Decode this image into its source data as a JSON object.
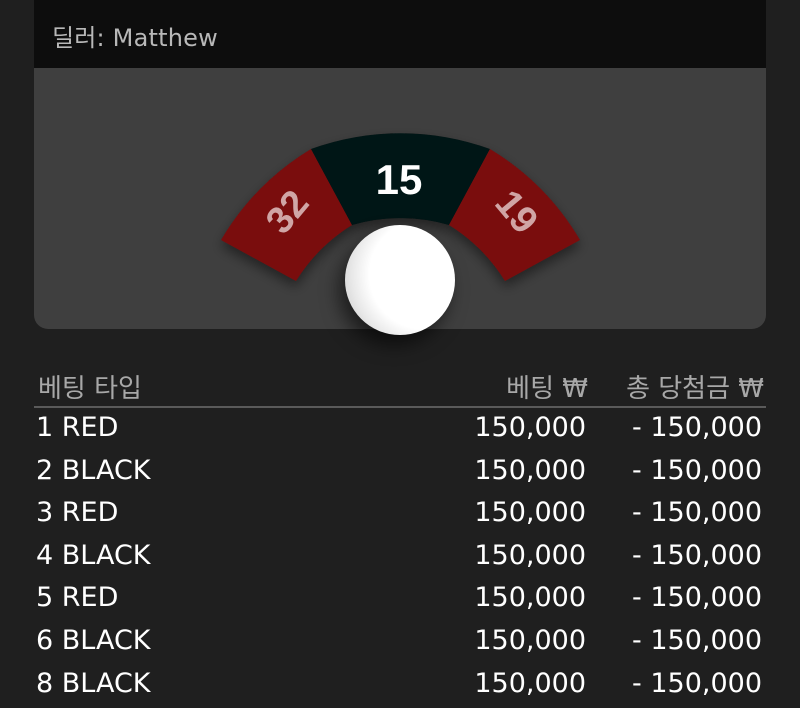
{
  "dealer": {
    "label": "딜러: Matthew"
  },
  "wheel": {
    "left_number": "32",
    "center_number": "15",
    "right_number": "19",
    "colors": {
      "red": "#7a0a0a",
      "black": "#041313",
      "panel": "#3f3f3f"
    }
  },
  "table": {
    "headers": {
      "bet_type": "베팅 타입",
      "bet": "베팅 ₩",
      "total_payout": "총 당첨금 ₩"
    },
    "rows": [
      {
        "type": "1 RED",
        "bet": "150,000",
        "payout": "- 150,000"
      },
      {
        "type": "2 BLACK",
        "bet": "150,000",
        "payout": "- 150,000"
      },
      {
        "type": "3 RED",
        "bet": "150,000",
        "payout": "- 150,000"
      },
      {
        "type": "4 BLACK",
        "bet": "150,000",
        "payout": "- 150,000"
      },
      {
        "type": "5 RED",
        "bet": "150,000",
        "payout": "- 150,000"
      },
      {
        "type": "6 BLACK",
        "bet": "150,000",
        "payout": "- 150,000"
      },
      {
        "type": "8 BLACK",
        "bet": "150,000",
        "payout": "- 150,000"
      }
    ]
  }
}
